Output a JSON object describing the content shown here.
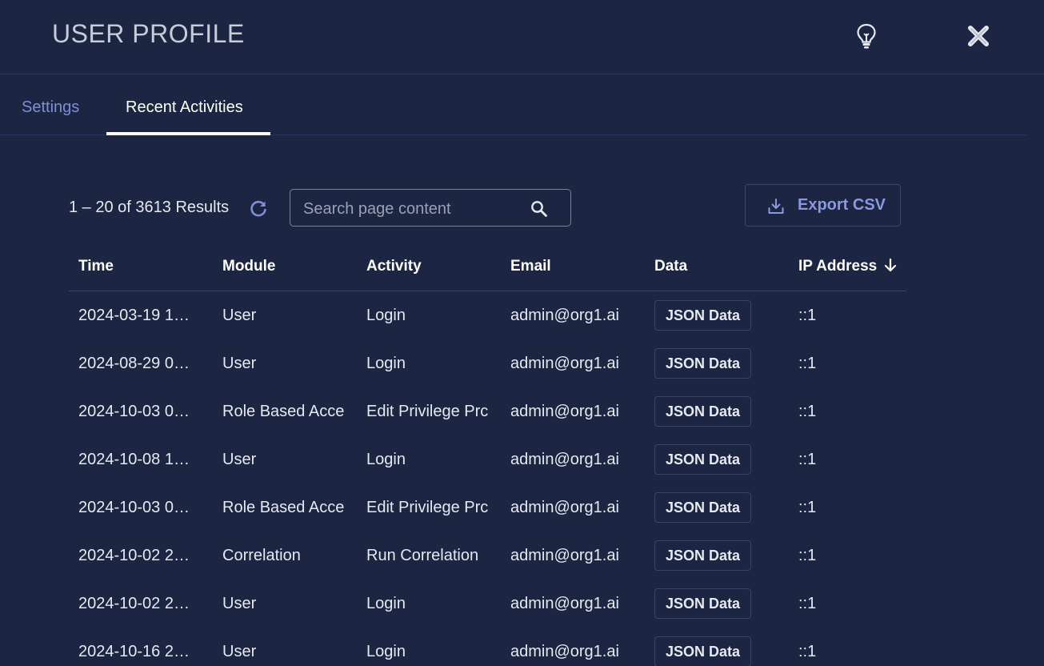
{
  "header": {
    "title": "USER PROFILE",
    "hint_icon": "lightbulb-icon",
    "close_icon": "close-icon"
  },
  "tabs": [
    {
      "label": "Settings",
      "active": false
    },
    {
      "label": "Recent Activities",
      "active": true
    }
  ],
  "toolbar": {
    "results_text": "1 – 20 of 3613 Results",
    "search_placeholder": "Search page content",
    "search_value": "",
    "export_label": "Export CSV"
  },
  "table": {
    "columns": [
      "Time",
      "Module",
      "Activity",
      "Email",
      "Data",
      "IP Address"
    ],
    "sort": {
      "column": "IP Address",
      "direction": "descending"
    },
    "rows": [
      {
        "time": "2024-03-19 1…",
        "module": "User",
        "activity": "Login",
        "email": "admin@org1.ai",
        "data": "JSON Data",
        "ip": "::1"
      },
      {
        "time": "2024-08-29 0…",
        "module": "User",
        "activity": "Login",
        "email": "admin@org1.ai",
        "data": "JSON Data",
        "ip": "::1"
      },
      {
        "time": "2024-10-03 0…",
        "module": "Role Based Acce",
        "activity": "Edit Privilege Prc",
        "email": "admin@org1.ai",
        "data": "JSON Data",
        "ip": "::1"
      },
      {
        "time": "2024-10-08 1…",
        "module": "User",
        "activity": "Login",
        "email": "admin@org1.ai",
        "data": "JSON Data",
        "ip": "::1"
      },
      {
        "time": "2024-10-03 0…",
        "module": "Role Based Acce",
        "activity": "Edit Privilege Prc",
        "email": "admin@org1.ai",
        "data": "JSON Data",
        "ip": "::1"
      },
      {
        "time": "2024-10-02 2…",
        "module": "Correlation",
        "activity": "Run Correlation",
        "email": "admin@org1.ai",
        "data": "JSON Data",
        "ip": "::1"
      },
      {
        "time": "2024-10-02 2…",
        "module": "User",
        "activity": "Login",
        "email": "admin@org1.ai",
        "data": "JSON Data",
        "ip": "::1"
      },
      {
        "time": "2024-10-16 2…",
        "module": "User",
        "activity": "Login",
        "email": "admin@org1.ai",
        "data": "JSON Data",
        "ip": "::1"
      }
    ]
  },
  "colors": {
    "background": "#1c2541",
    "accent": "#8a99de",
    "text": "#e6e9f2"
  }
}
